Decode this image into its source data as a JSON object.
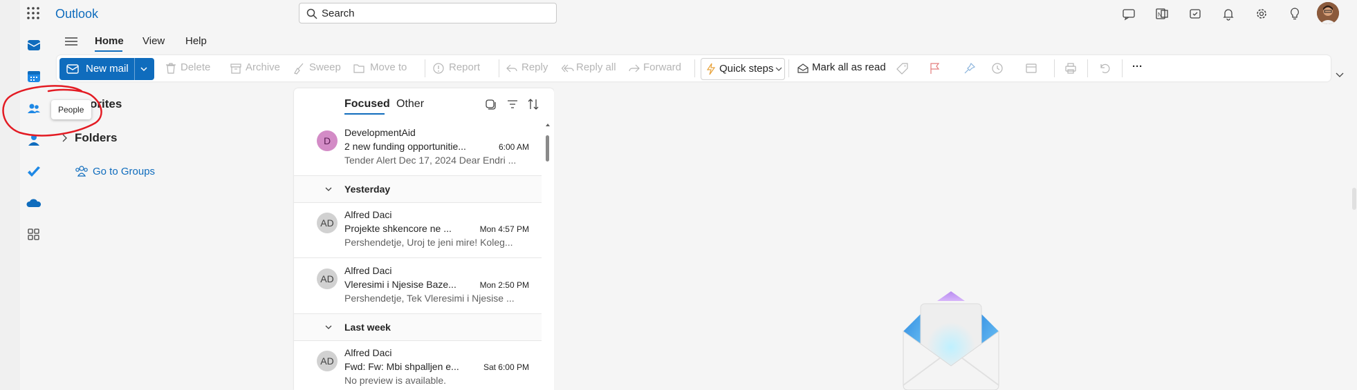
{
  "app": {
    "title": "Outlook"
  },
  "search": {
    "placeholder": "Search"
  },
  "menu_tabs": {
    "home": "Home",
    "view": "View",
    "help": "Help"
  },
  "ribbon": {
    "new_mail": "New mail",
    "delete": "Delete",
    "archive": "Archive",
    "sweep": "Sweep",
    "move_to": "Move to",
    "report": "Report",
    "reply": "Reply",
    "reply_all": "Reply all",
    "forward": "Forward",
    "quick_steps": "Quick steps",
    "mark_all_read": "Mark all as read",
    "more": "···"
  },
  "folder_pane": {
    "favorites": "orites",
    "folders": "Folders",
    "go_to_groups": "Go to Groups"
  },
  "tooltip": {
    "text": "People"
  },
  "message_list": {
    "tabs": {
      "focused": "Focused",
      "other": "Other"
    },
    "top_message": {
      "avatar": "D",
      "sender": "DevelopmentAid",
      "subject": "2 new funding opportunitie...",
      "time": "6:00 AM",
      "preview": "Tender Alert Dec 17, 2024 Dear Endri ..."
    },
    "groups": [
      {
        "label": "Yesterday",
        "messages": [
          {
            "avatar": "AD",
            "sender": "Alfred Daci",
            "subject": "Projekte shkencore ne ...",
            "time": "Mon 4:57 PM",
            "preview": "Pershendetje, Uroj te jeni mire! Koleg..."
          },
          {
            "avatar": "AD",
            "sender": "Alfred Daci",
            "subject": "Vleresimi i Njesise Baze...",
            "time": "Mon 2:50 PM",
            "preview": "Pershendetje, Tek Vleresimi i Njesise ..."
          }
        ]
      },
      {
        "label": "Last week",
        "messages": [
          {
            "avatar": "AD",
            "sender": "Alfred Daci",
            "subject": "Fwd: Fw: Mbi shpalljen e...",
            "time": "Sat 6:00 PM",
            "preview": "No preview is available."
          }
        ]
      }
    ]
  },
  "colors": {
    "accent": "#0f6cbd",
    "annotation": "#e31b23",
    "avatar_d": "#d38bc6",
    "avatar_ad": "#d1d1d1"
  },
  "icons": {
    "rail": [
      "mail-icon",
      "calendar-icon",
      "people-icon",
      "groups-icon",
      "todo-icon",
      "onedrive-icon",
      "apps-icon"
    ],
    "top": [
      "teams-chat-icon",
      "onenote-icon",
      "task-icon",
      "bell-icon",
      "gear-icon",
      "lightbulb-icon"
    ]
  }
}
